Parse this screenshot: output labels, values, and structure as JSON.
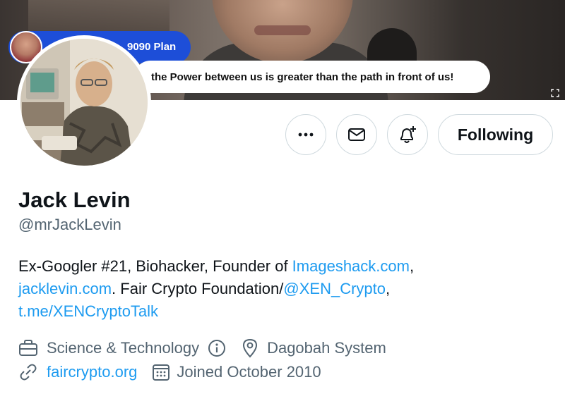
{
  "banner": {
    "plan_label": "9090 Plan",
    "quote": "the Power between us is greater than the path in front of us!"
  },
  "actions": {
    "more_icon": "more-horizontal-icon",
    "message_icon": "envelope-icon",
    "notify_icon": "bell-plus-icon",
    "following_label": "Following"
  },
  "profile": {
    "name": "Jack Levin",
    "handle": "@mrJackLevin",
    "bio": {
      "t1": "Ex-Googler #21, Biohacker, Founder of ",
      "link1": "Imageshack.com",
      "t2": ",",
      "link2": "jacklevin.com",
      "t3": ". Fair Crypto Foundation/",
      "link3": "@XEN_Crypto",
      "t4": ",",
      "link4": "t.me/XENCryptoTalk"
    },
    "category": "Science & Technology",
    "location": "Dagobah System",
    "website": "faircrypto.org",
    "joined": "Joined October 2010"
  },
  "colors": {
    "link": "#1d9bf0",
    "secondary_text": "#536471",
    "plan_pill": "#1d4ed8"
  }
}
